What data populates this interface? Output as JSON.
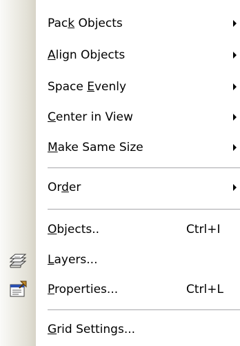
{
  "menu": {
    "items": [
      {
        "label": "Pack Objects",
        "mnemonic_index": 3,
        "submenu": true,
        "shortcut": ""
      },
      {
        "label": "Align Objects",
        "mnemonic_index": 0,
        "submenu": true,
        "shortcut": ""
      },
      {
        "label": "Space Evenly",
        "mnemonic_index": 6,
        "submenu": true,
        "shortcut": ""
      },
      {
        "label": "Center in View",
        "mnemonic_index": 0,
        "submenu": true,
        "shortcut": ""
      },
      {
        "label": "Make Same Size",
        "mnemonic_index": 0,
        "submenu": true,
        "shortcut": ""
      },
      {
        "label": "Order",
        "mnemonic_index": 2,
        "submenu": true,
        "shortcut": ""
      },
      {
        "label": "Objects..",
        "mnemonic_index": 0,
        "submenu": false,
        "shortcut": "Ctrl+I"
      },
      {
        "label": "Layers...",
        "mnemonic_index": 0,
        "submenu": false,
        "shortcut": "",
        "icon": "layers-icon"
      },
      {
        "label": "Properties...",
        "mnemonic_index": 0,
        "submenu": false,
        "shortcut": "Ctrl+L",
        "icon": "properties-icon"
      },
      {
        "label": "Grid Settings...",
        "mnemonic_index": 0,
        "submenu": false,
        "shortcut": ""
      }
    ]
  },
  "colors": {
    "menu_background": "#ffffff",
    "gutter_dark": "#d7d4c7",
    "separator": "#a7a6aa",
    "text": "#000000"
  }
}
